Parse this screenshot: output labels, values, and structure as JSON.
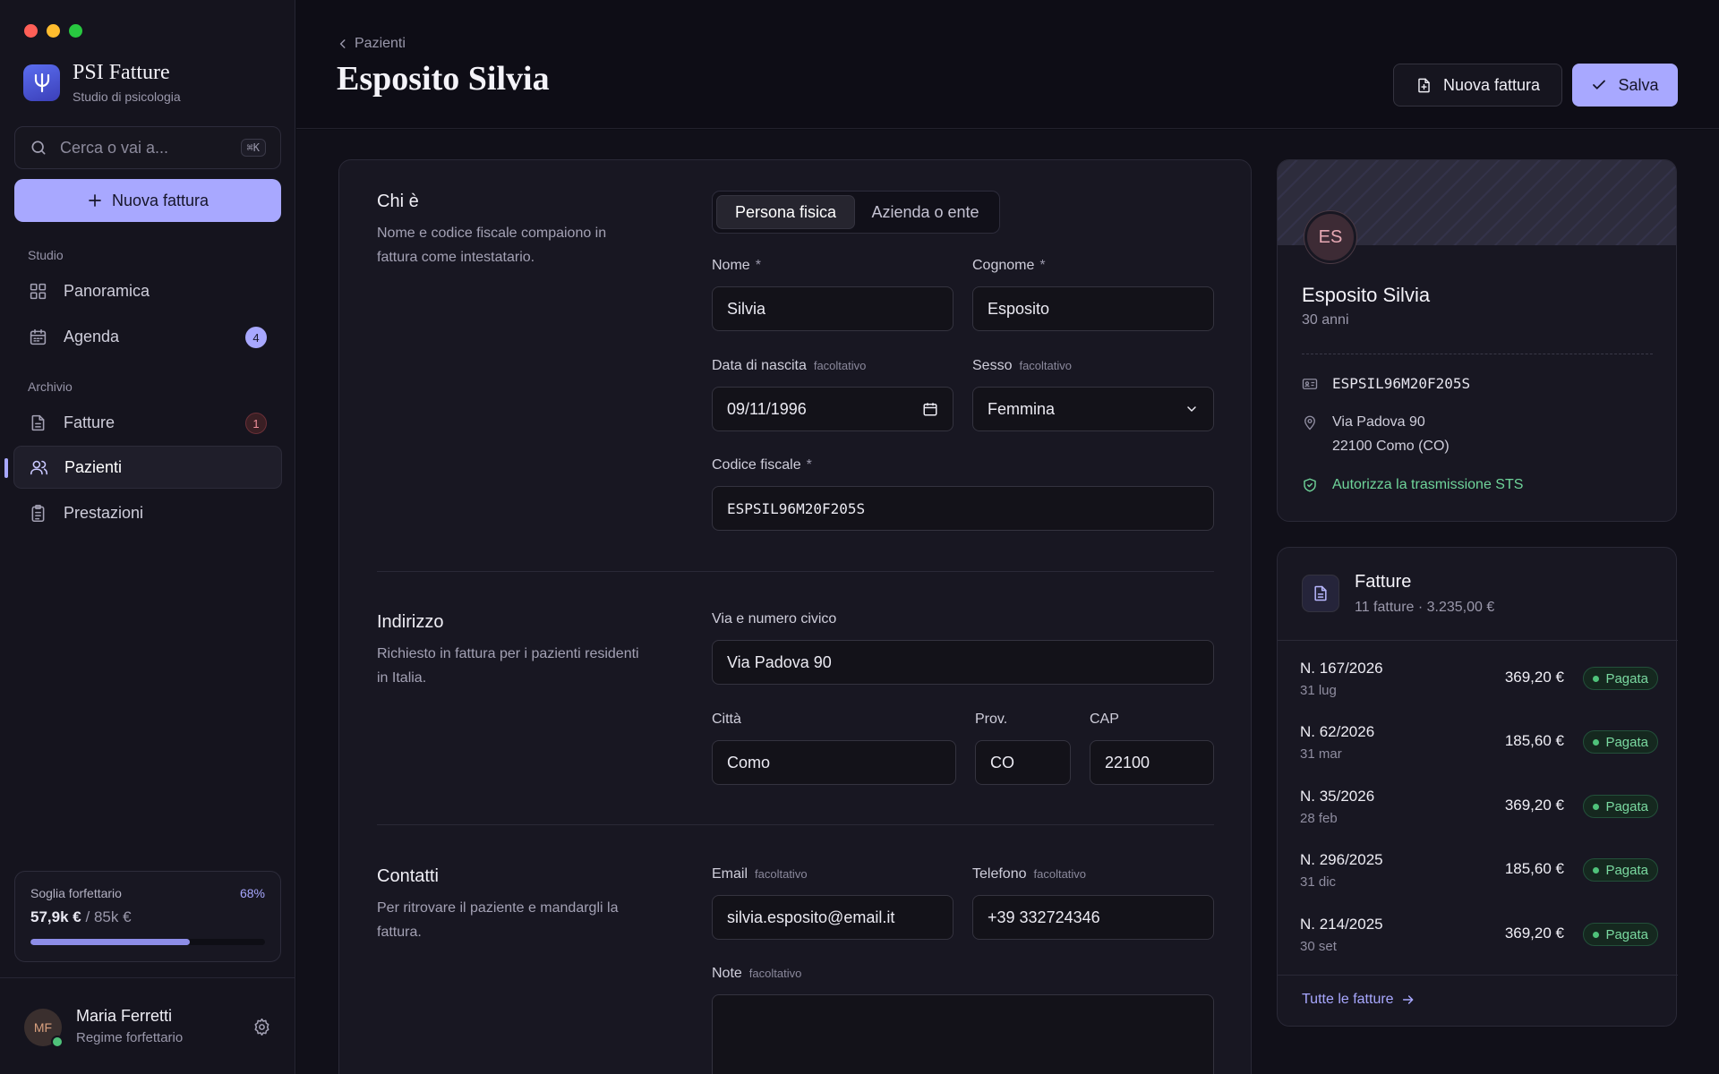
{
  "window_controls": {
    "close_color": "#ff5f57",
    "minimize_color": "#febc2e",
    "zoom_color": "#28c840"
  },
  "brand": {
    "title": "PSI Fatture",
    "subtitle": "Studio di psicologia",
    "logo_glyph": "Ψ"
  },
  "search": {
    "placeholder": "Cerca o vai a...",
    "shortcut": "⌘K"
  },
  "sidebar": {
    "new_invoice_label": "Nuova fattura",
    "section_studio": "Studio",
    "section_archivio": "Archivio",
    "items": [
      {
        "label": "Panoramica",
        "icon": "grid-icon"
      },
      {
        "label": "Agenda",
        "icon": "calendar-icon",
        "badge": "4"
      },
      {
        "label": "Fatture",
        "icon": "document-icon",
        "badge": "1"
      },
      {
        "label": "Pazienti",
        "icon": "users-icon",
        "active": true
      },
      {
        "label": "Prestazioni",
        "icon": "clipboard-icon"
      }
    ],
    "threshold": {
      "label": "Soglia forfettario",
      "percent_label": "68%",
      "percent": 0.68,
      "current": "57,9k €",
      "separator": "/",
      "max": "85k €"
    },
    "user": {
      "initials": "MF",
      "name": "Maria Ferretti",
      "role": "Regime forfettario"
    }
  },
  "header": {
    "breadcrumb": "Pazienti",
    "title": "Esposito Silvia",
    "new_invoice_label": "Nuova fattura",
    "save_label": "Salva"
  },
  "form": {
    "chi": {
      "title": "Chi è",
      "desc": "Nome e codice fiscale compaiono in fattura come intestatario.",
      "seg_person": "Persona fisica",
      "seg_company": "Azienda o ente",
      "nome_label": "Nome",
      "nome_value": "Silvia",
      "cognome_label": "Cognome",
      "cognome_value": "Esposito",
      "required_mark": "*",
      "nascita_label": "Data di nascita",
      "nascita_value": "09/11/1996",
      "sesso_label": "Sesso",
      "sesso_value": "Femmina",
      "optional": "facoltativo",
      "cf_label": "Codice fiscale",
      "cf_value": "ESPSIL96M20F205S"
    },
    "indirizzo": {
      "title": "Indirizzo",
      "desc": "Richiesto in fattura per i pazienti residenti in Italia.",
      "via_label": "Via e numero civico",
      "via_value": "Via Padova 90",
      "citta_label": "Città",
      "citta_value": "Como",
      "prov_label": "Prov.",
      "prov_value": "CO",
      "cap_label": "CAP",
      "cap_value": "22100"
    },
    "contatti": {
      "title": "Contatti",
      "desc": "Per ritrovare il paziente e mandargli la fattura.",
      "email_label": "Email",
      "email_value": "silvia.esposito@email.it",
      "tel_label": "Telefono",
      "tel_value": "+39 332724346",
      "note_label": "Note",
      "note_value": ""
    }
  },
  "profile": {
    "initials": "ES",
    "name": "Esposito Silvia",
    "age": "30 anni",
    "codice_fiscale": "ESPSIL96M20F205S",
    "address_line1": "Via Padova 90",
    "address_line2": "22100 Como (CO)",
    "sts": "Autorizza la trasmissione STS"
  },
  "invoices": {
    "title": "Fatture",
    "subtitle": "11 fatture · 3.235,00 €",
    "rows": [
      {
        "number": "N. 167/2026",
        "date": "31 lug",
        "amount": "369,20 €",
        "status": "Pagata"
      },
      {
        "number": "N. 62/2026",
        "date": "31 mar",
        "amount": "185,60 €",
        "status": "Pagata"
      },
      {
        "number": "N. 35/2026",
        "date": "28 feb",
        "amount": "369,20 €",
        "status": "Pagata"
      },
      {
        "number": "N. 296/2025",
        "date": "31 dic",
        "amount": "185,60 €",
        "status": "Pagata"
      },
      {
        "number": "N. 214/2025",
        "date": "30 set",
        "amount": "369,20 €",
        "status": "Pagata"
      }
    ],
    "all_link": "Tutte le fatture"
  },
  "colors": {
    "accent": "#a8a8ff",
    "success": "#4fc27a",
    "background": "#0d0d15"
  }
}
